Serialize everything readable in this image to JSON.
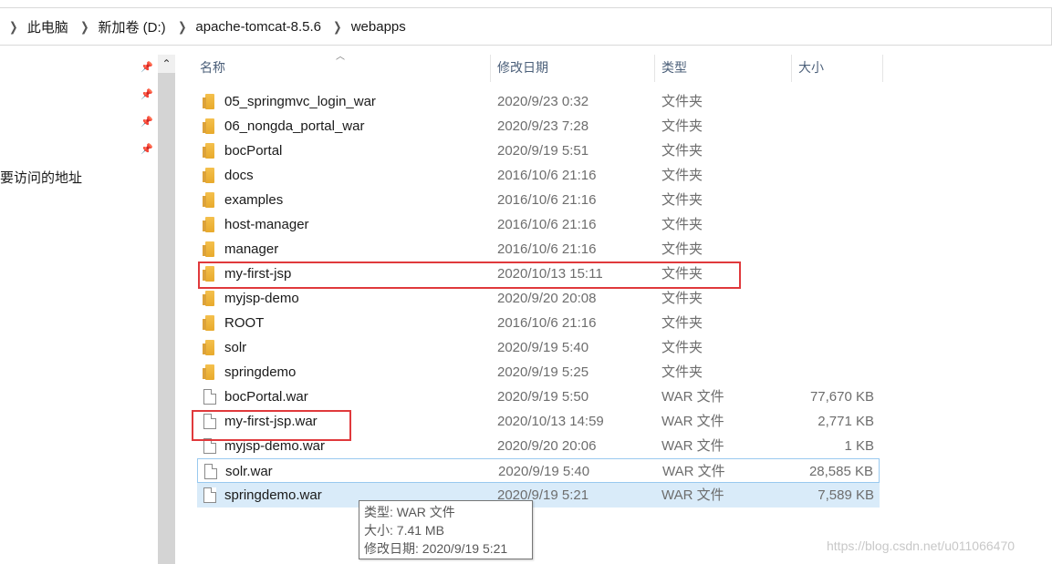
{
  "breadcrumb": [
    "此电脑",
    "新加卷 (D:)",
    "apache-tomcat-8.5.6",
    "webapps"
  ],
  "nav": {
    "quick_access_label": "要访问的地址"
  },
  "columns": {
    "name": "名称",
    "date": "修改日期",
    "type": "类型",
    "size": "大小"
  },
  "files": [
    {
      "name": "05_springmvc_login_war",
      "date": "2020/9/23 0:32",
      "type": "文件夹",
      "size": "",
      "kind": "folder"
    },
    {
      "name": "06_nongda_portal_war",
      "date": "2020/9/23 7:28",
      "type": "文件夹",
      "size": "",
      "kind": "folder"
    },
    {
      "name": "bocPortal",
      "date": "2020/9/19 5:51",
      "type": "文件夹",
      "size": "",
      "kind": "folder"
    },
    {
      "name": "docs",
      "date": "2016/10/6 21:16",
      "type": "文件夹",
      "size": "",
      "kind": "folder"
    },
    {
      "name": "examples",
      "date": "2016/10/6 21:16",
      "type": "文件夹",
      "size": "",
      "kind": "folder"
    },
    {
      "name": "host-manager",
      "date": "2016/10/6 21:16",
      "type": "文件夹",
      "size": "",
      "kind": "folder"
    },
    {
      "name": "manager",
      "date": "2016/10/6 21:16",
      "type": "文件夹",
      "size": "",
      "kind": "folder"
    },
    {
      "name": "my-first-jsp",
      "date": "2020/10/13 15:11",
      "type": "文件夹",
      "size": "",
      "kind": "folder"
    },
    {
      "name": "myjsp-demo",
      "date": "2020/9/20 20:08",
      "type": "文件夹",
      "size": "",
      "kind": "folder"
    },
    {
      "name": "ROOT",
      "date": "2016/10/6 21:16",
      "type": "文件夹",
      "size": "",
      "kind": "folder"
    },
    {
      "name": "solr",
      "date": "2020/9/19 5:40",
      "type": "文件夹",
      "size": "",
      "kind": "folder"
    },
    {
      "name": "springdemo",
      "date": "2020/9/19 5:25",
      "type": "文件夹",
      "size": "",
      "kind": "folder"
    },
    {
      "name": "bocPortal.war",
      "date": "2020/9/19 5:50",
      "type": "WAR 文件",
      "size": "77,670 KB",
      "kind": "file"
    },
    {
      "name": "my-first-jsp.war",
      "date": "2020/10/13 14:59",
      "type": "WAR 文件",
      "size": "2,771 KB",
      "kind": "file"
    },
    {
      "name": "myjsp-demo.war",
      "date": "2020/9/20 20:06",
      "type": "WAR 文件",
      "size": "1 KB",
      "kind": "file"
    },
    {
      "name": "solr.war",
      "date": "2020/9/19 5:40",
      "type": "WAR 文件",
      "size": "28,585 KB",
      "kind": "file",
      "state": "focused"
    },
    {
      "name": "springdemo.war",
      "date": "2020/9/19 5:21",
      "type": "WAR 文件",
      "size": "7,589 KB",
      "kind": "file",
      "state": "hover"
    }
  ],
  "tooltip": {
    "type_line": "类型: WAR 文件",
    "size_line": "大小: 7.41 MB",
    "date_line": "修改日期: 2020/9/19 5:21"
  },
  "watermark": "https://blog.csdn.net/u011066470",
  "colors": {
    "highlight_box": "#e0393c",
    "selection_bg": "#d9ebf9",
    "folder": "#f4c04d"
  },
  "icons": [
    "chevron-right-icon",
    "pin-icon",
    "folder-icon",
    "file-icon",
    "scroll-up-icon",
    "sort-up-icon"
  ]
}
